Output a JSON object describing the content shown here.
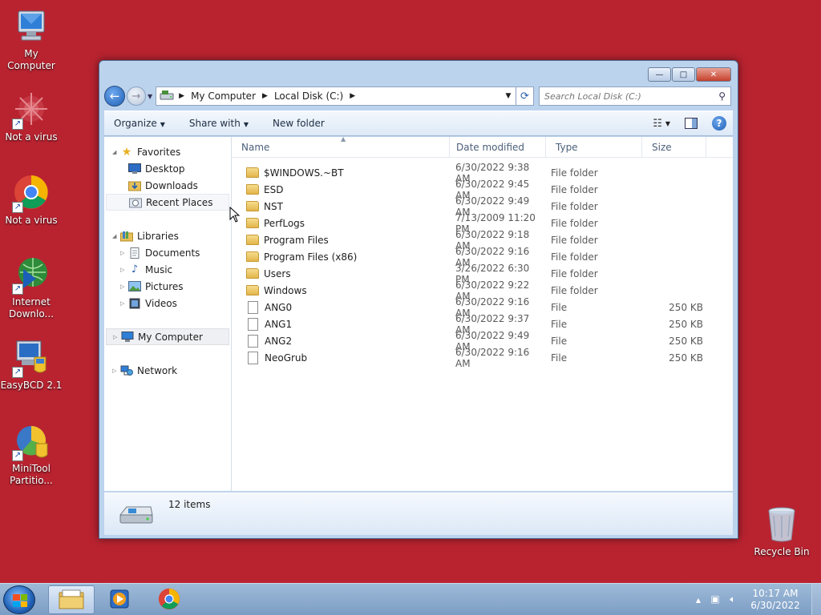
{
  "desktop": {
    "icons": [
      {
        "label": "My Computer",
        "icon": "computer-icon"
      },
      {
        "label": "Not a virus",
        "icon": "red-burst-icon"
      },
      {
        "label": "Not a virus",
        "icon": "chrome-icon"
      },
      {
        "label": "Internet Downlo...",
        "icon": "internet-download-manager-icon"
      },
      {
        "label": "EasyBCD 2.1",
        "icon": "easybcd-icon"
      },
      {
        "label": "MiniTool Partitio...",
        "icon": "minitool-partition-icon"
      },
      {
        "label": "Recycle Bin",
        "icon": "recycle-bin-icon"
      }
    ]
  },
  "window": {
    "controls": {
      "minimize": "—",
      "maximize": "□",
      "close": "✕"
    },
    "breadcrumb": [
      "My Computer",
      "Local Disk (C:)"
    ],
    "search_placeholder": "Search Local Disk (C:)",
    "toolbar": {
      "organize": "Organize",
      "share_with": "Share with",
      "new_folder": "New folder"
    },
    "nav": {
      "favorites": "Favorites",
      "desktop": "Desktop",
      "downloads": "Downloads",
      "recent_places": "Recent Places",
      "libraries": "Libraries",
      "documents": "Documents",
      "music": "Music",
      "pictures": "Pictures",
      "videos": "Videos",
      "my_computer": "My Computer",
      "network": "Network"
    },
    "columns": {
      "name": "Name",
      "date": "Date modified",
      "type": "Type",
      "size": "Size"
    },
    "files": [
      {
        "name": "$WINDOWS.~BT",
        "date": "6/30/2022 9:38 AM",
        "type": "File folder",
        "size": "",
        "kind": "folder"
      },
      {
        "name": "ESD",
        "date": "6/30/2022 9:45 AM",
        "type": "File folder",
        "size": "",
        "kind": "folder"
      },
      {
        "name": "NST",
        "date": "6/30/2022 9:49 AM",
        "type": "File folder",
        "size": "",
        "kind": "folder"
      },
      {
        "name": "PerfLogs",
        "date": "7/13/2009 11:20 PM",
        "type": "File folder",
        "size": "",
        "kind": "folder"
      },
      {
        "name": "Program Files",
        "date": "6/30/2022 9:18 AM",
        "type": "File folder",
        "size": "",
        "kind": "folder"
      },
      {
        "name": "Program Files (x86)",
        "date": "6/30/2022 9:16 AM",
        "type": "File folder",
        "size": "",
        "kind": "folder"
      },
      {
        "name": "Users",
        "date": "3/26/2022 6:30 PM",
        "type": "File folder",
        "size": "",
        "kind": "folder"
      },
      {
        "name": "Windows",
        "date": "6/30/2022 9:22 AM",
        "type": "File folder",
        "size": "",
        "kind": "folder"
      },
      {
        "name": "ANG0",
        "date": "6/30/2022 9:16 AM",
        "type": "File",
        "size": "250 KB",
        "kind": "file"
      },
      {
        "name": "ANG1",
        "date": "6/30/2022 9:37 AM",
        "type": "File",
        "size": "250 KB",
        "kind": "file"
      },
      {
        "name": "ANG2",
        "date": "6/30/2022 9:49 AM",
        "type": "File",
        "size": "250 KB",
        "kind": "file"
      },
      {
        "name": "NeoGrub",
        "date": "6/30/2022 9:16 AM",
        "type": "File",
        "size": "250 KB",
        "kind": "file"
      }
    ],
    "status": {
      "item_count": "12 items"
    }
  },
  "taskbar": {
    "pinned": [
      "windows-explorer-icon",
      "media-player-icon",
      "chrome-icon"
    ],
    "clock": {
      "time": "10:17 AM",
      "date": "6/30/2022"
    }
  },
  "colors": {
    "desktop_bg": "#b92330",
    "folder": "#e8bf57",
    "accent": "#1f5fb5"
  }
}
